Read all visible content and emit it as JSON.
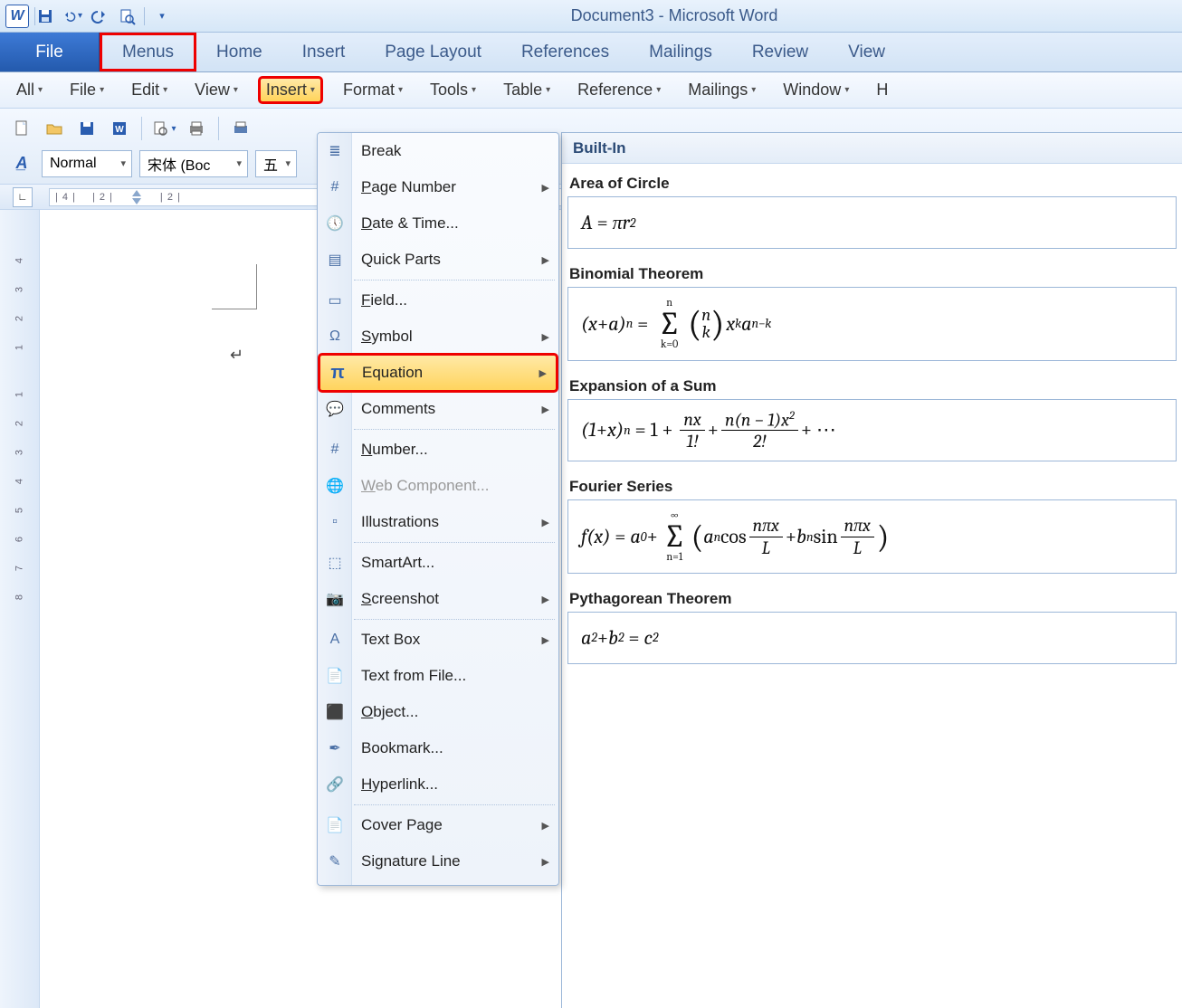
{
  "title": "Document3  -  Microsoft Word",
  "tabs": {
    "file": "File",
    "menus": "Menus",
    "home": "Home",
    "insert": "Insert",
    "pagelayout": "Page Layout",
    "references": "References",
    "mailings": "Mailings",
    "review": "Review",
    "view": "View"
  },
  "menus_bar": {
    "all": "All",
    "file": "File",
    "edit": "Edit",
    "view": "View",
    "insert": "Insert",
    "format": "Format",
    "tools": "Tools",
    "table": "Table",
    "reference": "Reference",
    "mailings": "Mailings",
    "window": "Window",
    "help_trunc": "H"
  },
  "toolbar": {
    "style_label": "Normal",
    "font_label": "宋体 (Boc",
    "size_label": "五"
  },
  "ruler": {
    "marks": [
      "| 4 |",
      "| 2 |",
      "",
      "| 2 |"
    ]
  },
  "vruler_ticks": [
    "4",
    "3",
    "2",
    "1",
    "",
    "1",
    "2",
    "3",
    "4",
    "5",
    "6",
    "7",
    "8"
  ],
  "dropdown": [
    {
      "label": "Break",
      "icon": "break-icon",
      "arrow": false
    },
    {
      "label": "Page Number",
      "icon": "pagenum-icon",
      "arrow": true,
      "ufirst": true
    },
    {
      "label": "Date & Time...",
      "icon": "datetime-icon",
      "arrow": false,
      "ufirst": true
    },
    {
      "label": "Quick Parts",
      "icon": "quickparts-icon",
      "arrow": true,
      "sep_after": true
    },
    {
      "label": "Field...",
      "icon": "field-icon",
      "arrow": false,
      "ufirst": true
    },
    {
      "label": "Symbol",
      "icon": "symbol-icon",
      "arrow": true,
      "ufirst": true
    },
    {
      "label": "Equation",
      "icon": "pi-icon",
      "arrow": true,
      "highlight": true,
      "hl_red": true
    },
    {
      "label": "Comments",
      "icon": "comment-icon",
      "arrow": true,
      "sep_after": true
    },
    {
      "label": "Number...",
      "icon": "number-icon",
      "arrow": false,
      "ufirst": true
    },
    {
      "label": "Web Component...",
      "icon": "web-icon",
      "arrow": false,
      "disabled": true,
      "ufirst": true
    },
    {
      "label": "Illustrations",
      "icon": "illus-icon",
      "arrow": true,
      "sep_after": true
    },
    {
      "label": "SmartArt...",
      "icon": "smartart-icon",
      "arrow": false
    },
    {
      "label": "Screenshot",
      "icon": "screenshot-icon",
      "arrow": true,
      "ufirst": true,
      "sep_after": true
    },
    {
      "label": "Text Box",
      "icon": "textbox-icon",
      "arrow": true
    },
    {
      "label": "Text from File...",
      "icon": "textfile-icon",
      "arrow": false
    },
    {
      "label": "Object...",
      "icon": "object-icon",
      "arrow": false,
      "ufirst": true
    },
    {
      "label": "Bookmark...",
      "icon": "bookmark-icon",
      "arrow": false
    },
    {
      "label": "Hyperlink...",
      "icon": "hyperlink-icon",
      "arrow": false,
      "ufirst": true,
      "sep_after": true
    },
    {
      "label": "Cover Page",
      "icon": "cover-icon",
      "arrow": true
    },
    {
      "label": "Signature Line",
      "icon": "sig-icon",
      "arrow": true
    }
  ],
  "gallery": {
    "header": "Built-In",
    "items": [
      {
        "title": "Area of Circle"
      },
      {
        "title": "Binomial Theorem"
      },
      {
        "title": "Expansion of a Sum"
      },
      {
        "title": "Fourier Series"
      },
      {
        "title": "Pythagorean Theorem"
      }
    ]
  }
}
